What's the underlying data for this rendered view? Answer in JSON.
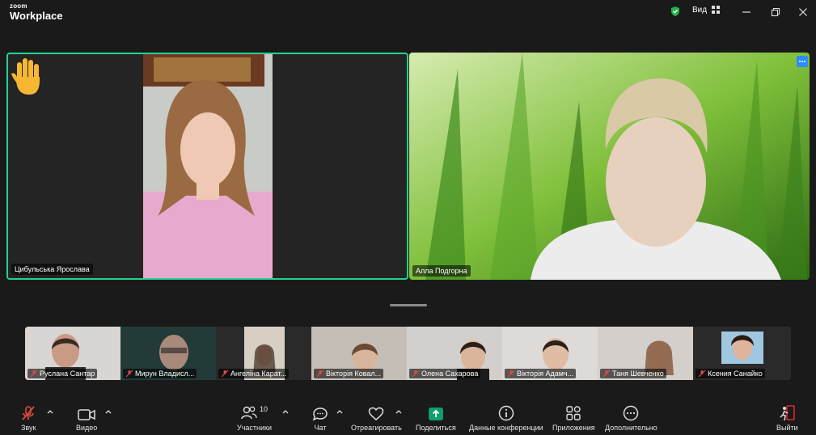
{
  "app": {
    "brand_top": "zoom",
    "brand_bottom": "Workplace"
  },
  "titlebar": {
    "view_label": "Вид"
  },
  "main_participants": [
    {
      "name": "Цибульська Ярослава",
      "reaction": "raised-hand"
    },
    {
      "name": "Алла Подгорна"
    }
  ],
  "thumbnails": [
    {
      "name": "Руслана Сантар",
      "muted": true
    },
    {
      "name": "Мирун Владисл...",
      "muted": true
    },
    {
      "name": "Ангеліна Карат...",
      "muted": true
    },
    {
      "name": "Вікторія Ковал...",
      "muted": true
    },
    {
      "name": "Олена Сахарова",
      "muted": true
    },
    {
      "name": "Вікторія Адамч...",
      "muted": true
    },
    {
      "name": "Таня Шевченко",
      "muted": true
    },
    {
      "name": "Ксения Санайко",
      "muted": true
    }
  ],
  "toolbar": {
    "audio": "Звук",
    "video": "Видео",
    "participants": "Участники",
    "participants_count": "10",
    "chat": "Чат",
    "react": "Отреагировать",
    "share": "Поделиться",
    "meeting_info": "Данные конференции",
    "apps": "Приложения",
    "more": "Дополнительно",
    "leave": "Выйти"
  },
  "colors": {
    "active_border": "#23d38f",
    "share_green": "#0e9f6e",
    "leave_red": "#e02828",
    "shield_green": "#23b14d"
  }
}
